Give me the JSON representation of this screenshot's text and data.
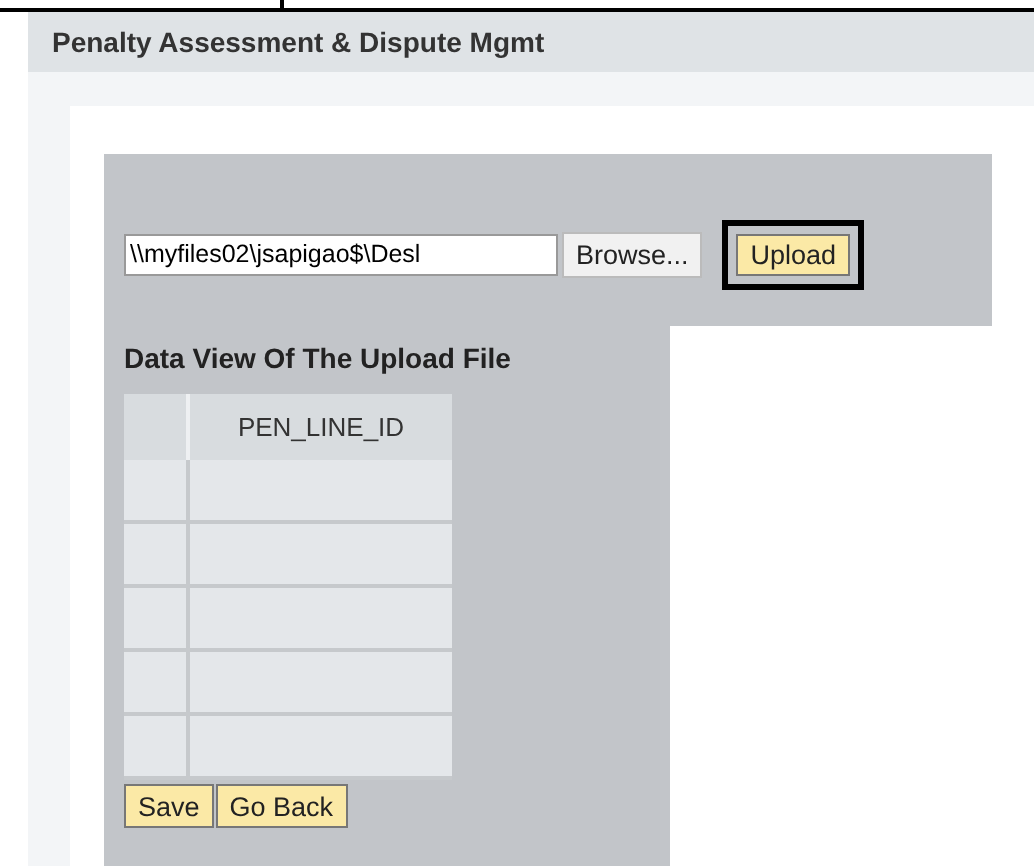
{
  "header": {
    "title": "Penalty Assessment & Dispute Mgmt"
  },
  "upload": {
    "file_path": "\\\\myfiles02\\jsapigao$\\Desl",
    "browse_label": "Browse...",
    "upload_label": "Upload",
    "upload_highlighted": true
  },
  "data_view": {
    "title": "Data View Of The Upload File",
    "columns": [
      "PEN_LINE_ID"
    ],
    "rows": [
      {
        "selected": false
      },
      {
        "selected": false
      },
      {
        "selected": false
      },
      {
        "selected": false
      },
      {
        "selected": false
      }
    ]
  },
  "buttons": [
    "Save",
    "Go Back"
  ]
}
